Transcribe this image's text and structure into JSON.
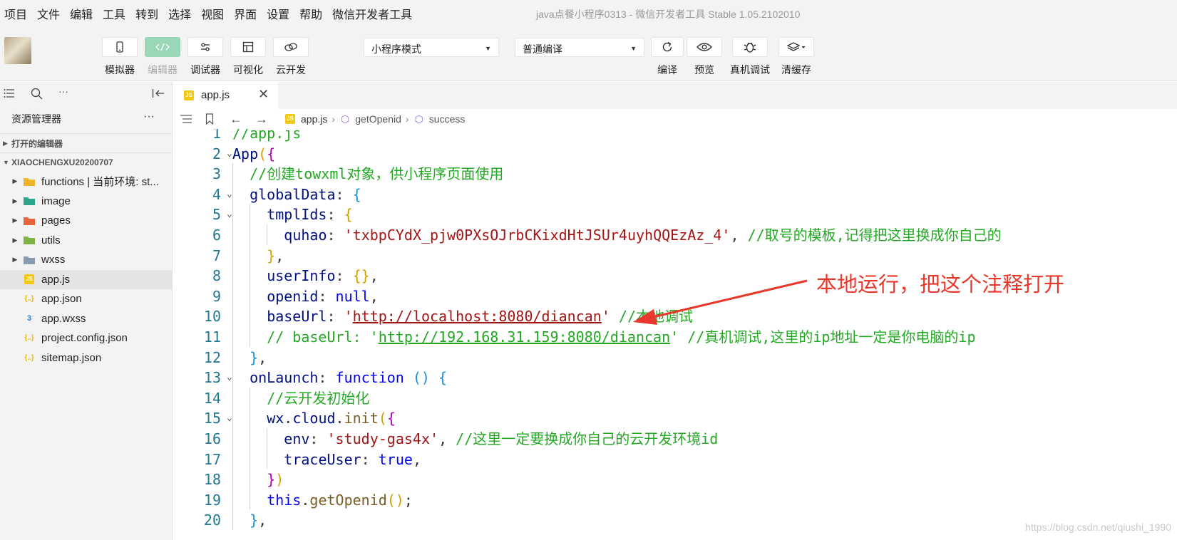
{
  "menubar": {
    "items": [
      "项目",
      "文件",
      "编辑",
      "工具",
      "转到",
      "选择",
      "视图",
      "界面",
      "设置",
      "帮助",
      "微信开发者工具"
    ],
    "window_title": "java点餐小程序0313 - 微信开发者工具 Stable 1.05.2102010"
  },
  "toolbar": {
    "simulator": "模拟器",
    "editor": "编辑器",
    "debugger": "调试器",
    "visualize": "可视化",
    "cloud": "云开发",
    "mode_select": "小程序模式",
    "compile_select": "普通编译",
    "compile": "编译",
    "preview": "预览",
    "real_debug": "真机调试",
    "clear_cache": "清缓存"
  },
  "sidebar": {
    "title": "资源管理器",
    "more": "···",
    "open_editors": "打开的编辑器",
    "project": "XIAOCHENGXU20200707",
    "tree": [
      {
        "label": "functions | 当前环境: st...",
        "icon": "folder-cloud-icon",
        "color": "#f0b429",
        "folder": true
      },
      {
        "label": "image",
        "icon": "folder-image-icon",
        "color": "#2ba58c",
        "folder": true
      },
      {
        "label": "pages",
        "icon": "folder-pages-icon",
        "color": "#e9643a",
        "folder": true
      },
      {
        "label": "utils",
        "icon": "folder-utils-icon",
        "color": "#7cb342",
        "folder": true
      },
      {
        "label": "wxss",
        "icon": "folder-icon",
        "color": "#8a9bb0",
        "folder": true
      },
      {
        "label": "app.js",
        "icon": "js-file-icon",
        "color": "#f2c811",
        "folder": false,
        "selected": true
      },
      {
        "label": "app.json",
        "icon": "json-file-icon",
        "color": "#f2b400",
        "folder": false
      },
      {
        "label": "app.wxss",
        "icon": "css-file-icon",
        "color": "#2d7bd4",
        "folder": false
      },
      {
        "label": "project.config.json",
        "icon": "json-file-icon",
        "color": "#f2b400",
        "folder": false
      },
      {
        "label": "sitemap.json",
        "icon": "json-file-icon",
        "color": "#f2b400",
        "folder": false
      }
    ]
  },
  "editor": {
    "tab": "app.js",
    "breadcrumb": [
      "app.js",
      "getOpenid",
      "success"
    ]
  },
  "code_lines": [
    {
      "n": "1",
      "fold": false,
      "indent": 0,
      "tokens": [
        [
          "//app.js",
          "c"
        ]
      ]
    },
    {
      "n": "2",
      "fold": true,
      "indent": 0,
      "tokens": [
        [
          "App",
          "p"
        ],
        [
          "(",
          "b1"
        ],
        [
          "{",
          "b2"
        ]
      ]
    },
    {
      "n": "3",
      "fold": false,
      "indent": 1,
      "tokens": [
        [
          "//创建towxml对象，供小程序页面使用",
          "c"
        ]
      ]
    },
    {
      "n": "4",
      "fold": true,
      "indent": 1,
      "tokens": [
        [
          "globalData",
          "p"
        ],
        [
          ": ",
          "n"
        ],
        [
          "{",
          "b3"
        ]
      ]
    },
    {
      "n": "5",
      "fold": true,
      "indent": 2,
      "tokens": [
        [
          "tmplIds",
          "p"
        ],
        [
          ": ",
          "n"
        ],
        [
          "{",
          "b1"
        ]
      ]
    },
    {
      "n": "6",
      "fold": false,
      "indent": 3,
      "tokens": [
        [
          "quhao",
          "p"
        ],
        [
          ": ",
          "n"
        ],
        [
          "'txbpCYdX_pjw0PXsOJrbCKixdHtJSUr4uyhQQEzAz_4'",
          "s"
        ],
        [
          ", ",
          "n"
        ],
        [
          "//取号的模板,记得把这里换成你自己的",
          "c"
        ]
      ]
    },
    {
      "n": "7",
      "fold": false,
      "indent": 2,
      "tokens": [
        [
          "}",
          "b1"
        ],
        [
          ",",
          "n"
        ]
      ]
    },
    {
      "n": "8",
      "fold": false,
      "indent": 2,
      "tokens": [
        [
          "userInfo",
          "p"
        ],
        [
          ": ",
          "n"
        ],
        [
          "{}",
          "b1"
        ],
        [
          ",",
          "n"
        ]
      ]
    },
    {
      "n": "9",
      "fold": false,
      "indent": 2,
      "tokens": [
        [
          "openid",
          "p"
        ],
        [
          ": ",
          "n"
        ],
        [
          "null",
          "k"
        ],
        [
          ",",
          "n"
        ]
      ]
    },
    {
      "n": "10",
      "fold": false,
      "indent": 2,
      "tokens": [
        [
          "baseUrl",
          "p"
        ],
        [
          ": ",
          "n"
        ],
        [
          "'",
          "s"
        ],
        [
          "http://localhost:8080/diancan",
          "su"
        ],
        [
          "'",
          "s"
        ],
        [
          " ",
          "n"
        ],
        [
          "//本地调试",
          "c"
        ]
      ]
    },
    {
      "n": "11",
      "fold": false,
      "indent": 2,
      "tokens": [
        [
          "// baseUrl: '",
          "c"
        ],
        [
          "http://192.168.31.159:8080/diancan",
          "cu"
        ],
        [
          "' //真机调试,这里的ip地址一定是你电脑的ip",
          "c"
        ]
      ]
    },
    {
      "n": "12",
      "fold": false,
      "indent": 1,
      "tokens": [
        [
          "}",
          "b3"
        ],
        [
          ",",
          "n"
        ]
      ]
    },
    {
      "n": "13",
      "fold": true,
      "indent": 1,
      "tokens": [
        [
          "onLaunch",
          "p"
        ],
        [
          ": ",
          "n"
        ],
        [
          "function",
          "k"
        ],
        [
          " ",
          "n"
        ],
        [
          "()",
          "b3"
        ],
        [
          " ",
          "n"
        ],
        [
          "{",
          "b3"
        ]
      ]
    },
    {
      "n": "14",
      "fold": false,
      "indent": 2,
      "tokens": [
        [
          "//云开发初始化",
          "c"
        ]
      ]
    },
    {
      "n": "15",
      "fold": true,
      "indent": 2,
      "tokens": [
        [
          "wx",
          "p"
        ],
        [
          ".",
          "n"
        ],
        [
          "cloud",
          "p"
        ],
        [
          ".",
          "n"
        ],
        [
          "init",
          "f"
        ],
        [
          "(",
          "b1"
        ],
        [
          "{",
          "b2"
        ]
      ]
    },
    {
      "n": "16",
      "fold": false,
      "indent": 3,
      "tokens": [
        [
          "env",
          "p"
        ],
        [
          ": ",
          "n"
        ],
        [
          "'study-gas4x'",
          "s"
        ],
        [
          ", ",
          "n"
        ],
        [
          "//这里一定要换成你自己的云开发环境id",
          "c"
        ]
      ]
    },
    {
      "n": "17",
      "fold": false,
      "indent": 3,
      "tokens": [
        [
          "traceUser",
          "p"
        ],
        [
          ": ",
          "n"
        ],
        [
          "true",
          "k"
        ],
        [
          ",",
          "n"
        ]
      ]
    },
    {
      "n": "18",
      "fold": false,
      "indent": 2,
      "tokens": [
        [
          "}",
          "b2"
        ],
        [
          ")",
          "b1"
        ]
      ]
    },
    {
      "n": "19",
      "fold": false,
      "indent": 2,
      "tokens": [
        [
          "this",
          "k"
        ],
        [
          ".",
          "n"
        ],
        [
          "getOpenid",
          "f"
        ],
        [
          "()",
          "b1"
        ],
        [
          ";",
          "n"
        ]
      ]
    },
    {
      "n": "20",
      "fold": false,
      "indent": 1,
      "tokens": [
        [
          "}",
          "b3"
        ],
        [
          ",",
          "n"
        ]
      ]
    }
  ],
  "annotation": {
    "text": "本地运行，把这个注释打开",
    "color": "#e8382c"
  },
  "watermark": "https://blog.csdn.net/qiushi_1990"
}
